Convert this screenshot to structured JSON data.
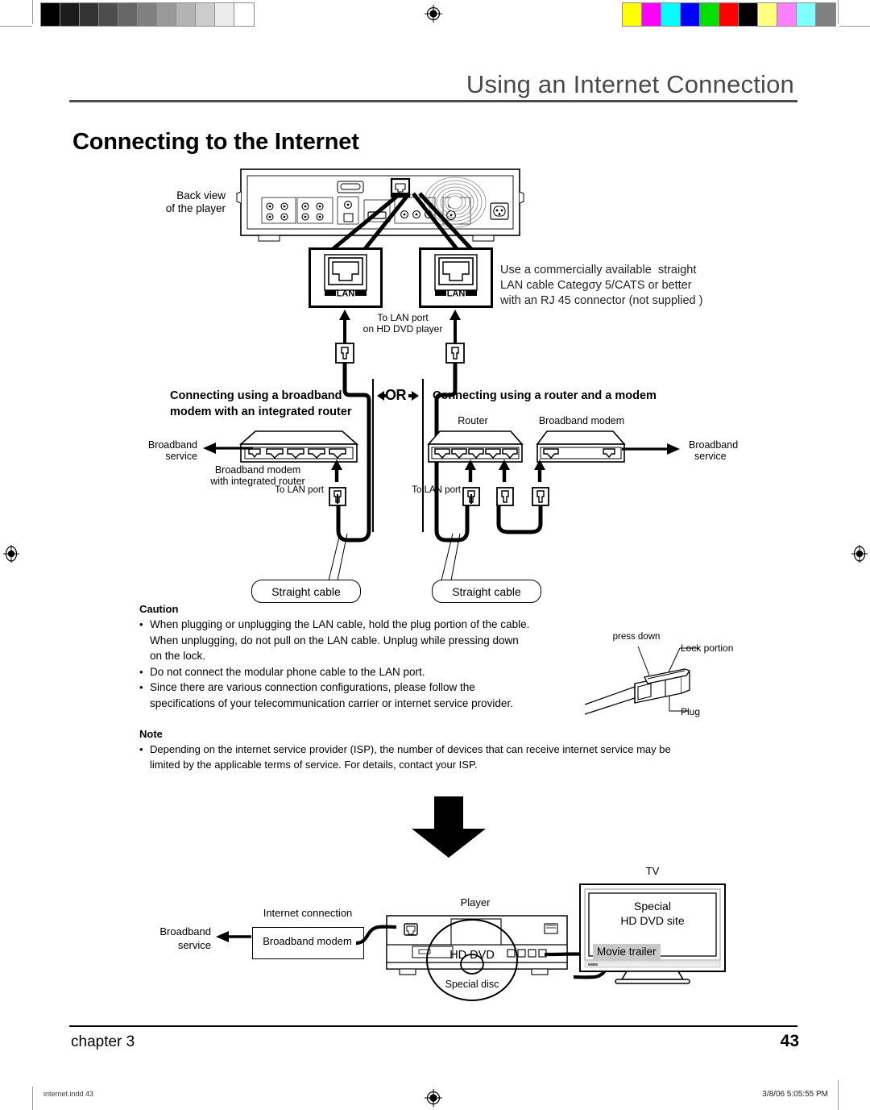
{
  "page": {
    "running_head": "Using an Internet Connection",
    "section_title": "Connecting to the Internet",
    "chapter_label": "chapter 3",
    "page_number": "43",
    "file_meta": "internet.indd   43",
    "print_meta": "3/8/06   5:05:55 PM"
  },
  "colorbars": {
    "grayscale": [
      "#000000",
      "#1c1c1c",
      "#333333",
      "#4d4d4d",
      "#666666",
      "#808080",
      "#999999",
      "#b3b3b3",
      "#cccccc",
      "#ececec",
      "#ffffff"
    ],
    "chroma": [
      "#ffff00",
      "#ff00ff",
      "#00ffff",
      "#0000ff",
      "#00e000",
      "#ff0000",
      "#000000",
      "#ffff80",
      "#ff80ff",
      "#80ffff",
      "#808080"
    ]
  },
  "diagram_top": {
    "back_view_label_line1": "Back view",
    "back_view_label_line2": "of the player",
    "port_left_label": "LAN",
    "port_right_label": "LAN",
    "to_lan_port_line1": "To LAN port",
    "to_lan_port_line2": "on HD DVD player",
    "cable_note_line1": "Use a commercially available  straight",
    "cable_note_line2": "LAN cable Categσy 5/CATS or better",
    "cable_note_line3": "with an RJ 45 connector (not supplied )"
  },
  "option_left": {
    "heading_line1": "Connecting using a broadband",
    "heading_line2": "modem with an integrated router",
    "broadband_service_line1": "Broadband",
    "broadband_service_line2": "service",
    "device_caption_line1": "Broadband modem",
    "device_caption_line2": "with integrated router",
    "to_lan_port": "To LAN port",
    "straight_cable": "Straight cable"
  },
  "or_divider": {
    "label": "OR"
  },
  "option_right": {
    "heading": "Connecting using a router and a modem",
    "router_label": "Router",
    "modem_label": "Broadband modem",
    "broadband_service_line1": "Broadband",
    "broadband_service_line2": "service",
    "to_lan_port": "To LAN port",
    "straight_cable": "Straight cable"
  },
  "caution": {
    "heading": "Caution",
    "items": [
      "When plugging or unplugging the LAN cable, hold the plug portion of the cable.\nWhen unplugging, do not pull on the LAN cable. Unplug while pressing down\non the lock.",
      "Do not connect the modular phone cable to the LAN port.",
      "Since there are various connection configurations, please follow the\nspecifications of your telecommunication carrier or internet service provider."
    ]
  },
  "plug_detail": {
    "press_down": "press down",
    "lock_portion": "Lock portion",
    "plug": "Plug"
  },
  "note": {
    "heading": "Note",
    "items": [
      "Depending on the internet service provider (ISP), the number of devices that can receive internet service may be\nlimited by the applicable terms of service. For details, contact your ISP."
    ]
  },
  "diagram_bottom": {
    "broadband_service_line1": "Broadband",
    "broadband_service_line2": "service",
    "internet_connection": "Internet connection",
    "broadband_modem": "Broadband modem",
    "player_label": "Player",
    "hd_dvd": "HD DVD",
    "special_disc": "Special disc",
    "tv_label": "TV",
    "tv_screen_line1": "Special",
    "tv_screen_line2": "HD DVD site",
    "movie_trailer": "Movie trailer"
  }
}
